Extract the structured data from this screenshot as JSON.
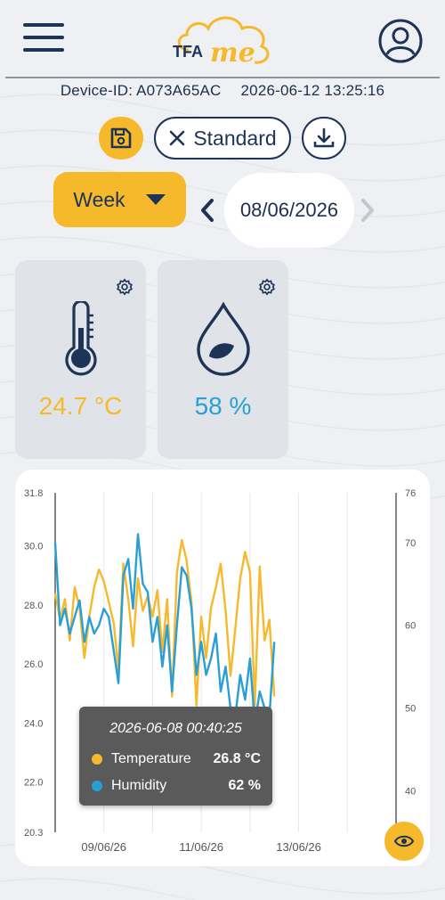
{
  "header": {
    "logo_text_left": "TFA",
    "logo_text_right": "me",
    "menu_icon": "hamburger-icon",
    "profile_icon": "user-icon"
  },
  "device": {
    "id_label": "Device-ID: A073A65AC",
    "timestamp": "2026-06-12 13:25:16"
  },
  "toolbar": {
    "save_icon": "save-icon",
    "standard_label": "Standard",
    "download_icon": "download-icon"
  },
  "period": {
    "selected": "Week",
    "date": "08/06/2026"
  },
  "cards": {
    "temperature": {
      "value": "24.7 °C",
      "color": "#f6b92b"
    },
    "humidity": {
      "value": "58 %",
      "color": "#2a9fd6"
    }
  },
  "chart_data": {
    "type": "line",
    "x_ticks": [
      "09/06/26",
      "11/06/26",
      "13/06/26"
    ],
    "y_left_ticks": [
      "31.8",
      "30.0",
      "28.0",
      "26.0",
      "24.0",
      "22.0",
      "20.3"
    ],
    "y_right_ticks": [
      "76",
      "70",
      "60",
      "50",
      "40"
    ],
    "y_left_range": [
      20.3,
      31.8
    ],
    "y_right_range": [
      35,
      76
    ],
    "x_range_days": [
      0,
      7
    ],
    "series": [
      {
        "name": "Temperature",
        "axis": "left",
        "color": "#f6b92b",
        "x": [
          0.0,
          0.1,
          0.2,
          0.3,
          0.4,
          0.5,
          0.6,
          0.7,
          0.8,
          0.9,
          1.0,
          1.1,
          1.2,
          1.3,
          1.4,
          1.5,
          1.6,
          1.7,
          1.8,
          1.9,
          2.0,
          2.1,
          2.2,
          2.3,
          2.4,
          2.5,
          2.6,
          2.7,
          2.8,
          2.9,
          3.0,
          3.1,
          3.2,
          3.3,
          3.4,
          3.5,
          3.6,
          3.7,
          3.8,
          3.9,
          4.0,
          4.1,
          4.2,
          4.3,
          4.4,
          4.5
        ],
        "values": [
          28.4,
          27.5,
          28.2,
          26.8,
          28.6,
          27.9,
          26.2,
          27.6,
          28.6,
          29.2,
          28.8,
          28.1,
          27.4,
          25.8,
          29.4,
          28.2,
          26.6,
          28.9,
          27.8,
          28.3,
          27.6,
          28.5,
          26.4,
          28.2,
          24.9,
          29.1,
          30.2,
          29.5,
          28.1,
          24.6,
          27.6,
          26.2,
          27.9,
          28.6,
          29.4,
          27.8,
          25.6,
          27.2,
          28.9,
          29.8,
          29.1,
          24.6,
          29.3,
          26.8,
          27.5,
          24.9
        ]
      },
      {
        "name": "Humidity",
        "axis": "right",
        "color": "#2a9fd6",
        "x": [
          0.0,
          0.1,
          0.2,
          0.3,
          0.4,
          0.5,
          0.6,
          0.7,
          0.8,
          0.9,
          1.0,
          1.1,
          1.2,
          1.3,
          1.4,
          1.5,
          1.6,
          1.7,
          1.8,
          1.9,
          2.0,
          2.1,
          2.2,
          2.3,
          2.4,
          2.5,
          2.6,
          2.7,
          2.8,
          2.9,
          3.0,
          3.1,
          3.2,
          3.3,
          3.4,
          3.5,
          3.6,
          3.7,
          3.8,
          3.9,
          4.0,
          4.1,
          4.2,
          4.3,
          4.4,
          4.5
        ],
        "values": [
          70,
          60,
          62,
          59,
          61,
          63,
          58,
          61,
          59,
          60,
          62,
          61,
          57,
          53,
          66,
          68,
          62,
          71,
          65,
          64,
          58,
          61,
          55,
          60,
          52,
          60,
          67,
          66,
          62,
          54,
          58,
          54,
          56,
          59,
          52,
          55,
          50,
          49,
          54,
          51,
          56,
          48,
          52,
          50,
          49,
          58
        ]
      }
    ],
    "tooltip": {
      "timestamp": "2026-06-08 00:40:25",
      "rows": [
        {
          "label": "Temperature",
          "value": "26.8 °C",
          "color": "#f6b92b"
        },
        {
          "label": "Humidity",
          "value": "62 %",
          "color": "#2a9fd6"
        }
      ]
    }
  },
  "eye_icon": "eye-icon"
}
